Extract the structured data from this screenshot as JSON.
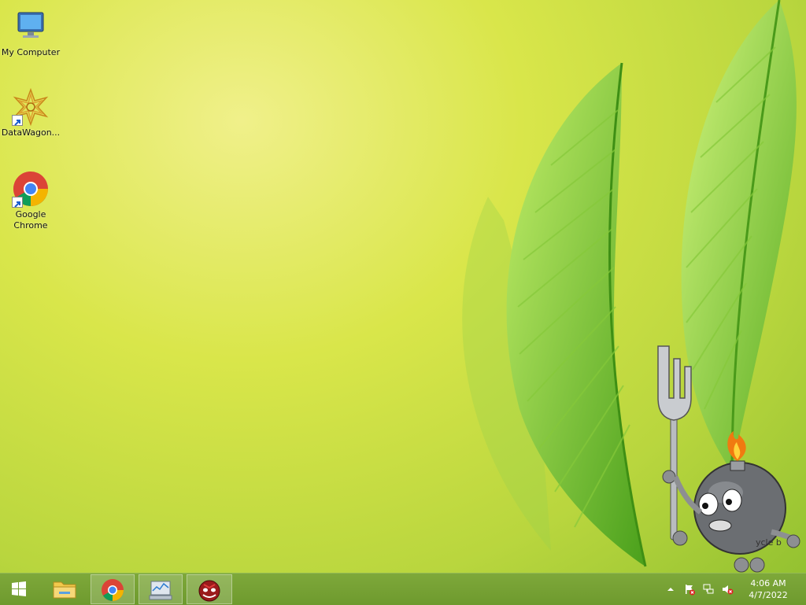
{
  "desktop": {
    "icons": [
      {
        "label": "My Computer",
        "icon": "computer-icon"
      },
      {
        "label": "DataWagon...",
        "icon": "datawagon-icon"
      },
      {
        "label": "Google Chrome",
        "icon": "chrome-icon"
      }
    ],
    "mascot_partial_label": "ycle b"
  },
  "taskbar": {
    "start_icon": "windows-start-icon",
    "apps": [
      {
        "name": "File Explorer",
        "icon": "folder-icon"
      },
      {
        "name": "Google Chrome",
        "icon": "chrome-icon"
      },
      {
        "name": "Resource Monitor",
        "icon": "monitor-icon"
      },
      {
        "name": "Bomb App",
        "icon": "bomb-face-icon"
      }
    ],
    "tray": {
      "clock_time": "4:06 AM",
      "clock_date": "4/7/2022"
    }
  },
  "colors": {
    "taskbar": "#7ea83a",
    "leaf": "#6fbf1f"
  }
}
